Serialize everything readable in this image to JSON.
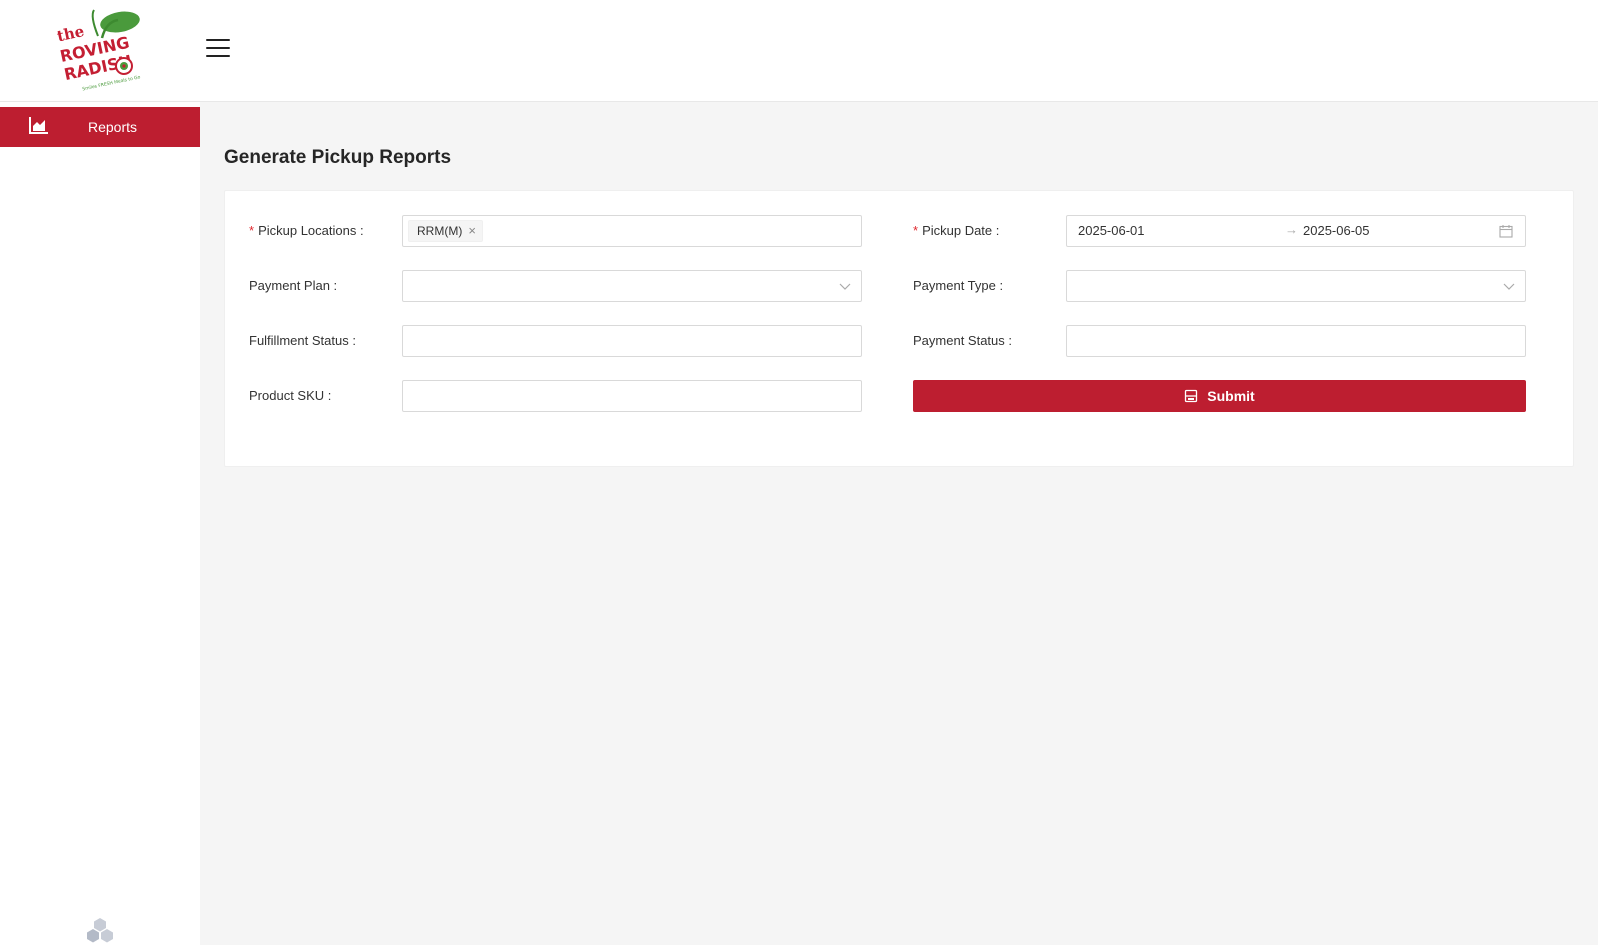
{
  "app": {
    "logo": {
      "text_top": "the",
      "text_mid": "ROVING",
      "text_bottom": "RADISH",
      "tagline": "Smiles FRESH Meals to Go"
    }
  },
  "sidebar": {
    "items": [
      {
        "label": "Reports",
        "icon": "area-chart-icon",
        "active": true
      }
    ],
    "footer_icon": "cubes-icon"
  },
  "page": {
    "title": "Generate Pickup Reports"
  },
  "form": {
    "required_mark": "*",
    "pickup_locations": {
      "label": "Pickup Locations :",
      "required": true,
      "tags": [
        "RRM(M)"
      ],
      "tag_close": "×"
    },
    "pickup_date": {
      "label": "Pickup Date :",
      "required": true,
      "start": "2025-06-01",
      "arrow": "→",
      "end": "2025-06-05"
    },
    "payment_plan": {
      "label": "Payment Plan :",
      "value": ""
    },
    "payment_type": {
      "label": "Payment Type :",
      "value": ""
    },
    "fulfillment_status": {
      "label": "Fulfillment Status :",
      "value": ""
    },
    "payment_status": {
      "label": "Payment Status :",
      "value": ""
    },
    "product_sku": {
      "label": "Product SKU :",
      "value": ""
    },
    "submit_label": "Submit"
  },
  "colors": {
    "accent": "#bd1e30",
    "content_bg": "#f5f5f5",
    "required": "#e0282e"
  }
}
